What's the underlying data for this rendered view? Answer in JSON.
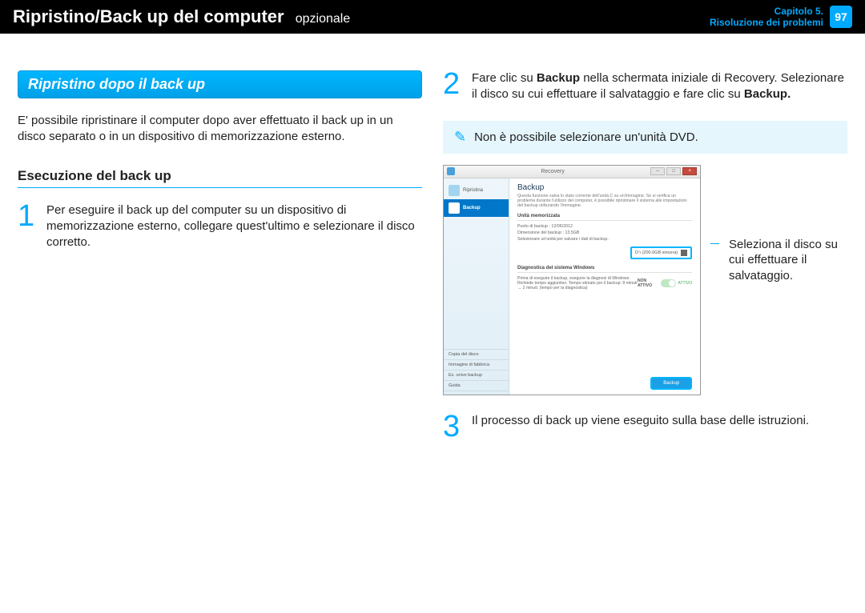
{
  "header": {
    "title": "Ripristino/Back up del computer",
    "subtitle": "opzionale",
    "chapter_line1": "Capitolo 5.",
    "chapter_line2": "Risoluzione dei problemi",
    "page_number": "97"
  },
  "left": {
    "section_title": "Ripristino dopo il back up",
    "intro": "E' possibile ripristinare il computer dopo aver effettuato il back up in un disco separato o in un dispositivo di memorizzazione esterno.",
    "subheading": "Esecuzione del back up",
    "step1_num": "1",
    "step1_text": "Per eseguire il back up del computer su un dispositivo di memorizzazione esterno, collegare quest'ultimo e selezionare il disco corretto."
  },
  "right": {
    "step2_num": "2",
    "step2_text_a": "Fare clic su ",
    "step2_bold_a": "Backup",
    "step2_text_b": " nella schermata iniziale di Recovery. Selezionare il disco su cui effettuare il salvataggio e fare clic su ",
    "step2_bold_b": "Backup.",
    "note": "Non è possibile selezionare un'unità DVD.",
    "callout": "Seleziona il disco su cui effettuare il salvataggio.",
    "step3_num": "3",
    "step3_text": "Il processo di back up viene eseguito sulla base delle istruzioni."
  },
  "screenshot": {
    "window_title": "Recovery",
    "side_item1": "Ripristina",
    "side_item2": "Backup",
    "side_bottom1": "Copia del disco",
    "side_bottom2": "Immagine di fabbrica",
    "side_bottom3": "Es. unive backup",
    "side_bottom4": "Guida",
    "main_title": "Backup",
    "main_desc": "Questa funzione salva lo stato corrente dell'unità C su un'immagine. Se si verifica un problema durante l'utilizzo del computer, è possibile ripristinare il sistema alle impostazioni del backup utilizzando l'immagine.",
    "section_units": "Unità memorizzata",
    "row_date": "Punto di backup : 12/06/2012",
    "row_size": "Dimensione del backup : 13.5GB",
    "row_select": "Selezionare un'unità per salvare i dati di backup.",
    "disk_label": "D:\\ (200.0GB sincera)",
    "section_diag": "Diagnostica del sistema Windows",
    "diag_text": "Prima di eseguire il backup, eseguire la diagnosi di Windows. Richiede tempo aggiuntivo. Tempo stimato per il backup: 8 minuti → 2 minuti. (tempo per la diagnostica)",
    "toggle_off": "NON ATTIVO",
    "toggle_on": "ATTIVO",
    "backup_btn": "Backup"
  }
}
